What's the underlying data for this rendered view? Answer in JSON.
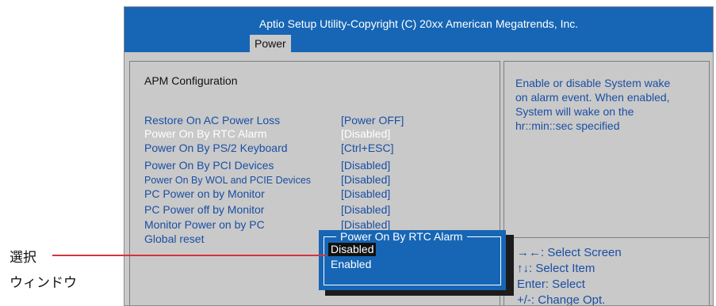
{
  "header": {
    "title": "Aptio Setup Utility-Copyright (C) 20xx American Megatrends, Inc.",
    "tab": "Power"
  },
  "main": {
    "section_title": "APM  Configuration",
    "items": [
      {
        "label": "Restore On AC Power Loss",
        "value": "[Power OFF]",
        "highlighted": false
      },
      {
        "label": "Power On By RTC Alarm",
        "value": "[Disabled]",
        "highlighted": true
      },
      {
        "label": "Power On By PS/2 Keyboard",
        "value": "[Ctrl+ESC]",
        "highlighted": false
      },
      {
        "label": "Power On By PCI Devices",
        "value": "[Disabled]",
        "highlighted": false
      },
      {
        "label": "Power On By WOL and PCIE Devices",
        "value": "[Disabled]",
        "highlighted": false
      },
      {
        "label": "PC Power on by Monitor",
        "value": "[Disabled]",
        "highlighted": false
      },
      {
        "label": "PC Power off by Monitor",
        "value": "[Disabled]",
        "highlighted": false
      },
      {
        "label": "Monitor Power on by PC",
        "value": "[Disabled]",
        "highlighted": false
      },
      {
        "label": "Global reset",
        "value": "",
        "highlighted": false
      }
    ]
  },
  "help": {
    "lines": [
      "Enable or disable System wake",
      "on alarm event. When enabled,",
      "System will wake on the",
      "hr::min::sec specified"
    ]
  },
  "keys": [
    "→←: Select Screen",
    "↑↓: Select Item",
    "Enter: Select",
    "+/-: Change Opt."
  ],
  "popup": {
    "title": "Power On By RTC Alarm",
    "options": [
      "Disabled",
      "Enabled"
    ],
    "selected_index": 0
  },
  "annotation": {
    "line1": "選択",
    "line2": "ウィンドウ"
  },
  "colors": {
    "header_bg": "#1766b5",
    "item_text": "#1a4fa3",
    "highlight_text": "#ffffff",
    "panel_bg": "#c9c9c9",
    "annotation_line": "#d3343d"
  }
}
